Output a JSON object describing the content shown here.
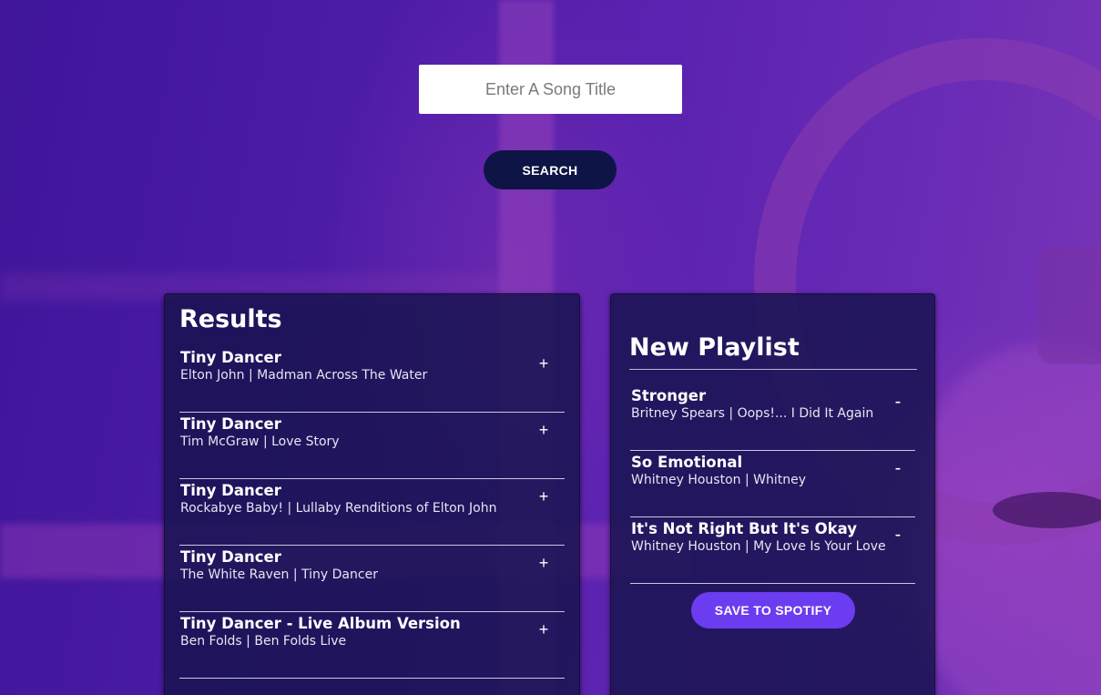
{
  "search": {
    "placeholder": "Enter A Song Title",
    "value": "",
    "button_label": "SEARCH"
  },
  "results": {
    "title": "Results",
    "action_symbol": "+",
    "tracks": [
      {
        "name": "Tiny Dancer",
        "info": "Elton John | Madman Across The Water"
      },
      {
        "name": "Tiny Dancer",
        "info": "Tim McGraw | Love Story"
      },
      {
        "name": "Tiny Dancer",
        "info": "Rockabye Baby! | Lullaby Renditions of Elton John"
      },
      {
        "name": "Tiny Dancer",
        "info": "The White Raven | Tiny Dancer"
      },
      {
        "name": "Tiny Dancer - Live Album Version",
        "info": "Ben Folds | Ben Folds Live"
      }
    ]
  },
  "playlist": {
    "name": "New Playlist",
    "action_symbol": "-",
    "tracks": [
      {
        "name": "Stronger",
        "info": "Britney Spears | Oops!... I Did It Again"
      },
      {
        "name": "So Emotional",
        "info": "Whitney Houston | Whitney"
      },
      {
        "name": "It's Not Right But It's Okay",
        "info": "Whitney Houston | My Love Is Your Love"
      }
    ],
    "save_label": "SAVE TO SPOTIFY"
  },
  "colors": {
    "background": "#4a1aa0",
    "panel": "#181450",
    "search_button": "#0f1447",
    "save_button": "#6c3cf0"
  }
}
